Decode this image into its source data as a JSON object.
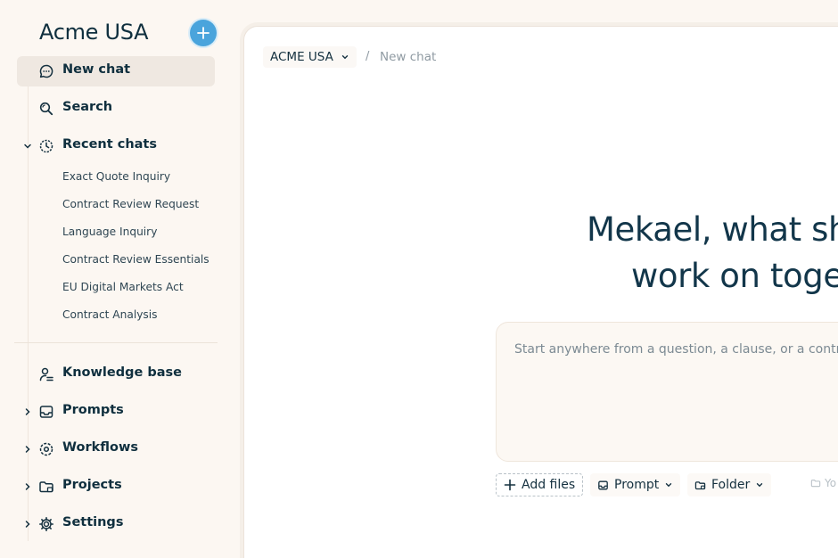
{
  "sidebar": {
    "org_title": "Acme USA",
    "nav": {
      "new_chat": "New chat",
      "search": "Search",
      "recent_chats": "Recent chats",
      "knowledge_base": "Knowledge base",
      "prompts": "Prompts",
      "workflows": "Workflows",
      "projects": "Projects",
      "settings": "Settings"
    },
    "recent": [
      "Exact Quote Inquiry",
      "Contract Review Request",
      "Language Inquiry",
      "Contract Review Essentials",
      "EU Digital Markets Act",
      "Contract Analysis"
    ]
  },
  "breadcrumb": {
    "org": "ACME USA",
    "separator": "/",
    "current": "New chat"
  },
  "main": {
    "headline_line1": "Mekael, what sh",
    "headline_line2": "work on toget",
    "prompt_placeholder": "Start anywhere from a question, a clause, or a contrac",
    "toolbar": {
      "add_files": "Add files",
      "prompt": "Prompt",
      "folder": "Folder",
      "faded": "Yo"
    }
  },
  "colors": {
    "accent": "#4aa4dc",
    "text": "#0f2f3e",
    "sidebar_bg": "#fcf7f2",
    "active_bg": "#efe8e1"
  }
}
